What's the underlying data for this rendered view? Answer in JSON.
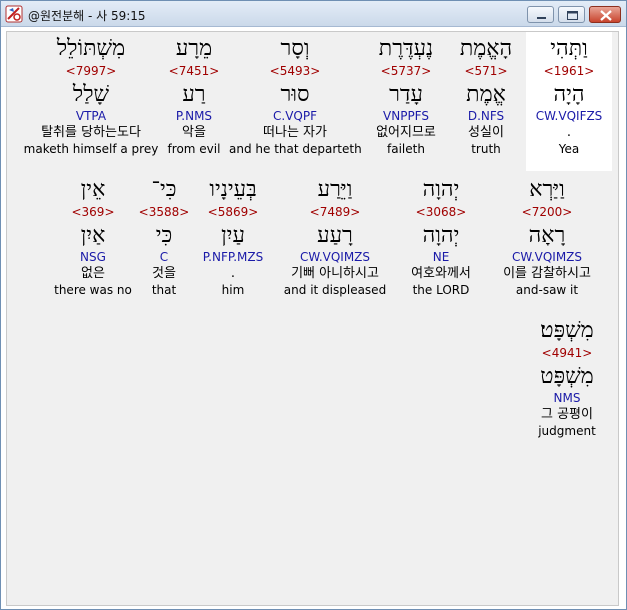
{
  "window": {
    "title": "@원전분해 - 사 59:15",
    "icon": "app-bible-icon",
    "controls": [
      "minimize-icon",
      "maximize-icon",
      "close-icon"
    ]
  },
  "rows": [
    {
      "words": [
        {
          "hebrew": "וַתְּהִי",
          "strong": "<1961>",
          "lemma": "הָיָה",
          "morph": "CW.VQIFZS",
          "korean": ".",
          "english": "Yea",
          "highlighted": true
        },
        {
          "hebrew": "הָאֱמֶת",
          "strong": "<571>",
          "lemma": "אֱמֶת",
          "morph": "D.NFS",
          "korean": "성실이",
          "english": "truth"
        },
        {
          "hebrew": "נֶעְדֶּרֶת",
          "strong": "<5737>",
          "lemma": "עָדַר",
          "morph": "VNPPFS",
          "korean": "없어지므로",
          "english": "faileth"
        },
        {
          "hebrew": "וְסָר",
          "strong": "<5493>",
          "lemma": "סוּר",
          "morph": "C.VQPF",
          "korean": "떠나는 자가",
          "english": "and he that departeth"
        },
        {
          "hebrew": "מֵרָע",
          "strong": "<7451>",
          "lemma": "רַע",
          "morph": "P.NMS",
          "korean": "악을",
          "english": "from evil"
        },
        {
          "hebrew": "מִשְׁתּוֹלֵל",
          "strong": "<7997>",
          "lemma": "שָׁלַל",
          "morph": "VTPA",
          "korean": "탈취를 당하는도다",
          "english": "maketh himself a prey"
        }
      ]
    },
    {
      "words": [
        {
          "hebrew": "וַיַּרְא",
          "strong": "<7200>",
          "lemma": "רָאָה",
          "morph": "CW.VQIMZS",
          "korean": "이를 감찰하시고",
          "english": "and-saw it"
        },
        {
          "hebrew": "יְהוָה",
          "strong": "<3068>",
          "lemma": "יְהוָה",
          "morph": "NE",
          "korean": "여호와께서",
          "english": "the LORD"
        },
        {
          "hebrew": "וַיֵּרַע",
          "strong": "<7489>",
          "lemma": "רָעַע",
          "morph": "CW.VQIMZS",
          "korean": "기뻐 아니하시고",
          "english": "and it displeased"
        },
        {
          "hebrew": "בְּעֵינָיו",
          "strong": "<5869>",
          "lemma": "עַיִן",
          "morph": "P.NFP.MZS",
          "korean": ".",
          "english": "him"
        },
        {
          "hebrew": "כִּי־",
          "strong": "<3588>",
          "lemma": "כִּי",
          "morph": "C",
          "korean": "것을",
          "english": "that"
        },
        {
          "hebrew": "אֵין",
          "strong": "<369>",
          "lemma": "אַיִן",
          "morph": "NSG",
          "korean": "없은",
          "english": "there was no"
        }
      ]
    },
    {
      "words": [
        {
          "hebrew": "מִשְׁפָּט׃",
          "strong": "<4941>",
          "lemma": "מִשְׁפָּט",
          "morph": "NMS",
          "korean": "그 공평이",
          "english": "judgment"
        }
      ]
    }
  ]
}
